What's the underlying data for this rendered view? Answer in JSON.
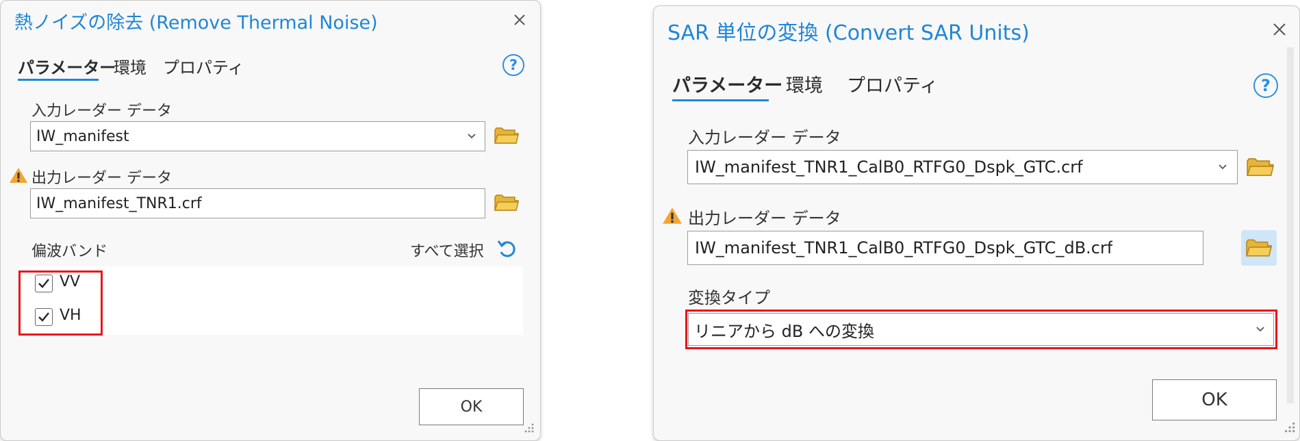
{
  "left_dialog": {
    "title": "熱ノイズの除去 (Remove Thermal Noise)",
    "tabs": [
      "パラメーター",
      "環境",
      "プロパティ"
    ],
    "help_symbol": "?",
    "input_label": "入力レーダー データ",
    "input_value": "IW_manifest",
    "output_label": "出力レーダー データ",
    "output_value": "IW_manifest_TNR1.crf",
    "polar_label": "偏波バンド",
    "select_all": "すべて選択",
    "checks": [
      {
        "label": "VV",
        "checked": true
      },
      {
        "label": "VH",
        "checked": true
      }
    ],
    "ok_label": "OK"
  },
  "right_dialog": {
    "title": "SAR 単位の変換 (Convert SAR Units)",
    "tabs": [
      "パラメーター",
      "環境",
      "プロパティ"
    ],
    "help_symbol": "?",
    "input_label": "入力レーダー データ",
    "input_value": "IW_manifest_TNR1_CalB0_RTFG0_Dspk_GTC.crf",
    "output_label": "出力レーダー データ",
    "output_value": "IW_manifest_TNR1_CalB0_RTFG0_Dspk_GTC_dB.crf",
    "conv_label": "変換タイプ",
    "conv_value": "リニアから dB への変換",
    "ok_label": "OK"
  },
  "colors": {
    "accent": "#1f86d6",
    "highlight": "#e8141b",
    "warning": "#f2a533",
    "folder": "#e5b53a"
  },
  "icons": [
    "close-icon",
    "help-icon",
    "chevron-down-icon",
    "folder-icon",
    "warning-icon",
    "refresh-icon",
    "checkmark-icon",
    "resize-grip-icon"
  ]
}
